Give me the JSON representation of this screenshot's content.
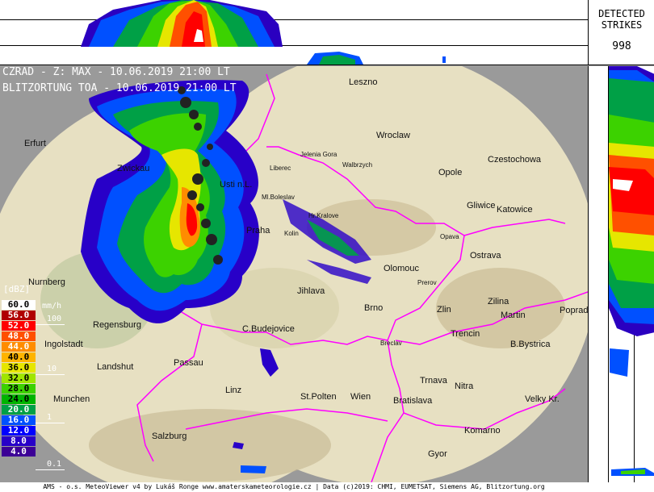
{
  "title_line_1": "CZRAD - Z: MAX - 10.06.2019 21:00 LT",
  "title_line_2": "BLITZORTUNG TOA - 10.06.2019 21:00 LT",
  "strikes": {
    "label": "DETECTED\nSTRIKES",
    "count": "998"
  },
  "legend": {
    "unit": "[dBZ]",
    "rate_unit": "mm/h",
    "rows": [
      {
        "dbz": "60.0",
        "bg": "#ffffff",
        "fg": "#000000"
      },
      {
        "dbz": "56.0",
        "bg": "#b00000",
        "fg": "#ffffff"
      },
      {
        "dbz": "52.0",
        "bg": "#ff0000",
        "fg": "#ffffff"
      },
      {
        "dbz": "48.0",
        "bg": "#ff5000",
        "fg": "#ffffff"
      },
      {
        "dbz": "44.0",
        "bg": "#ff8c00",
        "fg": "#ffffff"
      },
      {
        "dbz": "40.0",
        "bg": "#ffb400",
        "fg": "#000000"
      },
      {
        "dbz": "36.0",
        "bg": "#e6e600",
        "fg": "#000000"
      },
      {
        "dbz": "32.0",
        "bg": "#a0e600",
        "fg": "#000000"
      },
      {
        "dbz": "28.0",
        "bg": "#3cd200",
        "fg": "#000000"
      },
      {
        "dbz": "24.0",
        "bg": "#00b400",
        "fg": "#000000"
      },
      {
        "dbz": "20.0",
        "bg": "#00a046",
        "fg": "#ffffff"
      },
      {
        "dbz": "16.0",
        "bg": "#0050ff",
        "fg": "#ffffff"
      },
      {
        "dbz": "12.0",
        "bg": "#0000ff",
        "fg": "#ffffff"
      },
      {
        "dbz": "8.0",
        "bg": "#2800c8",
        "fg": "#ffffff"
      },
      {
        "dbz": "4.0",
        "bg": "#3c0096",
        "fg": "#ffffff"
      }
    ],
    "rates": [
      "100",
      "10",
      "1",
      "0.1"
    ]
  },
  "cities": [
    {
      "name": "Leszno"
    },
    {
      "name": "Erfurt"
    },
    {
      "name": "Wroclaw"
    },
    {
      "name": "Jelenia Gora"
    },
    {
      "name": "Walbrzych"
    },
    {
      "name": "Czestochowa"
    },
    {
      "name": "Zwickau"
    },
    {
      "name": "Liberec"
    },
    {
      "name": "Opole"
    },
    {
      "name": "Usti n.L."
    },
    {
      "name": "Ml.Boleslav"
    },
    {
      "name": "Gliwice"
    },
    {
      "name": "Katowice"
    },
    {
      "name": "Hr.Kralove"
    },
    {
      "name": "Praha"
    },
    {
      "name": "Kolin"
    },
    {
      "name": "Opava"
    },
    {
      "name": "Ostrava"
    },
    {
      "name": "Nurnberg"
    },
    {
      "name": "Olomouc"
    },
    {
      "name": "Prerov"
    },
    {
      "name": "Jihlava"
    },
    {
      "name": "Zilina"
    },
    {
      "name": "Brno"
    },
    {
      "name": "Zlin"
    },
    {
      "name": "Martin"
    },
    {
      "name": "Poprad"
    },
    {
      "name": "Regensburg"
    },
    {
      "name": "C.Budejovice"
    },
    {
      "name": "Trencin"
    },
    {
      "name": "Ingolstadt"
    },
    {
      "name": "Breclav"
    },
    {
      "name": "B.Bystrica"
    },
    {
      "name": "Passau"
    },
    {
      "name": "Landshut"
    },
    {
      "name": "Trnava"
    },
    {
      "name": "Nitra"
    },
    {
      "name": "Linz"
    },
    {
      "name": "Munchen"
    },
    {
      "name": "St.Polten"
    },
    {
      "name": "Wien"
    },
    {
      "name": "Bratislava"
    },
    {
      "name": "Velky Kr."
    },
    {
      "name": "Komarno"
    },
    {
      "name": "Salzburg"
    },
    {
      "name": "Gyor"
    }
  ],
  "footer": "AMS - o.s. MeteoViewer v4 by Lukáš Ronge www.amaterskameteorologie.cz | Data (c)2019: CHMI, EUMETSAT, Siemens AG, Blitzortung.org",
  "colors": {
    "border": "#ff00ff",
    "frame": "#9a9a9a",
    "map_land": "#e7e0c2"
  }
}
